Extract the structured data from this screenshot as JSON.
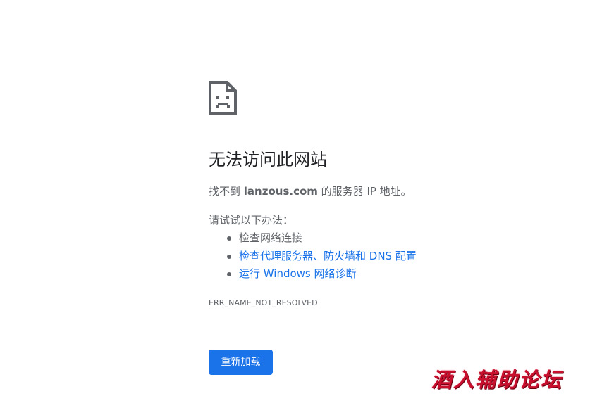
{
  "error_page": {
    "icon": "sad-page-icon",
    "title": "无法访问此网站",
    "summary": {
      "prefix": "找不到 ",
      "host": "lanzous.com",
      "suffix": " 的服务器 IP 地址。"
    },
    "suggestions_heading": "请试试以下办法：",
    "suggestions": [
      {
        "label": "检查网络连接",
        "link": false
      },
      {
        "label": "检查代理服务器、防火墙和 DNS 配置",
        "link": true
      },
      {
        "label": "运行 Windows 网络诊断",
        "link": true
      }
    ],
    "error_code": "ERR_NAME_NOT_RESOLVED",
    "reload_label": "重新加载"
  },
  "watermark": {
    "text": "酒入辅助论坛"
  },
  "colors": {
    "text": "#202124",
    "secondary": "#5f6368",
    "link": "#1a73e8",
    "button_bg": "#1a73e8",
    "watermark": "#c8102e"
  }
}
